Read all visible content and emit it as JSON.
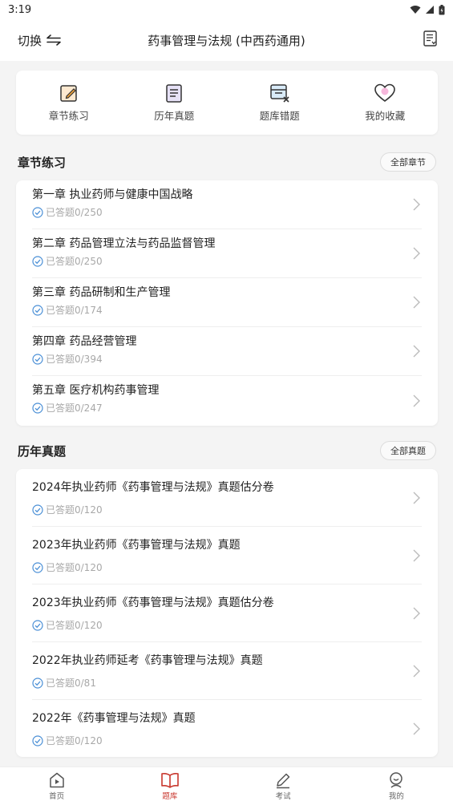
{
  "status_bar": {
    "time": "3:19"
  },
  "app_bar": {
    "switch_label": "切换",
    "title": "药事管理与法规 (中西药通用)"
  },
  "quick_actions": [
    {
      "label": "章节练习",
      "icon": "edit-note-icon"
    },
    {
      "label": "历年真题",
      "icon": "document-list-icon"
    },
    {
      "label": "题库错题",
      "icon": "wrong-questions-icon"
    },
    {
      "label": "我的收藏",
      "icon": "heart-icon"
    }
  ],
  "chapters": {
    "title": "章节练习",
    "all_label": "全部章节",
    "items": [
      {
        "title": "第一章 执业药师与健康中国战略",
        "progress": "已答题0/250"
      },
      {
        "title": "第二章 药品管理立法与药品监督管理",
        "progress": "已答题0/250"
      },
      {
        "title": "第三章 药品研制和生产管理",
        "progress": "已答题0/174"
      },
      {
        "title": "第四章 药品经营管理",
        "progress": "已答题0/394"
      },
      {
        "title": "第五章 医疗机构药事管理",
        "progress": "已答题0/247"
      }
    ]
  },
  "past_papers": {
    "title": "历年真题",
    "all_label": "全部真题",
    "items": [
      {
        "title": "2024年执业药师《药事管理与法规》真题估分卷",
        "progress": "已答题0/120"
      },
      {
        "title": "2023年执业药师《药事管理与法规》真题",
        "progress": "已答题0/120"
      },
      {
        "title": "2023年执业药师《药事管理与法规》真题估分卷",
        "progress": "已答题0/120"
      },
      {
        "title": "2022年执业药师延考《药事管理与法规》真题",
        "progress": "已答题0/81"
      },
      {
        "title": "2022年《药事管理与法规》真题",
        "progress": "已答题0/120"
      }
    ]
  },
  "bottom_nav": [
    {
      "label": "首页",
      "icon": "home-play-icon",
      "active": false
    },
    {
      "label": "题库",
      "icon": "book-icon",
      "active": true
    },
    {
      "label": "考试",
      "icon": "pencil-icon",
      "active": false
    },
    {
      "label": "我的",
      "icon": "profile-icon",
      "active": false
    }
  ],
  "colors": {
    "accent": "#c8362c",
    "check": "#4a8fd6",
    "background": "#f4f4f4"
  }
}
